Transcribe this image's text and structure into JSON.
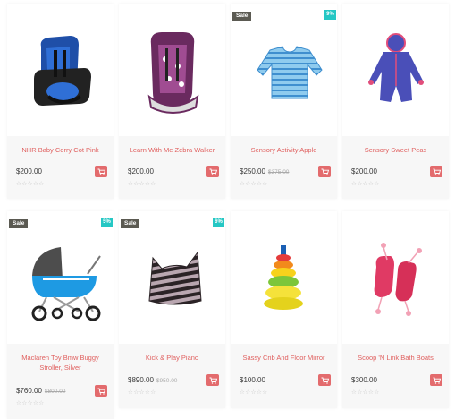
{
  "colors": {
    "title": "#e0605f",
    "cart_button": "#e36b6d",
    "sale_badge": "#5b5a52",
    "percent_badge": "#25c7c4",
    "info_bg": "#f7f7f7"
  },
  "products": [
    {
      "title": "NHR Baby Corry Cot Pink",
      "price": "$200.00",
      "old_price": "",
      "stars": "☆☆☆☆☆",
      "badge_sale": "",
      "badge_pct": "",
      "image": "car-seat-blue"
    },
    {
      "title": "Learn With Me Zebra Walker",
      "price": "$200.00",
      "old_price": "",
      "stars": "☆☆☆☆☆",
      "badge_sale": "",
      "badge_pct": "",
      "image": "car-seat-purple"
    },
    {
      "title": "Sensory Activity Apple",
      "price": "$250.00",
      "old_price": "$375.00",
      "stars": "☆☆☆☆☆",
      "badge_sale": "Sale",
      "badge_pct": "9%",
      "image": "striped-bodysuit"
    },
    {
      "title": "Sensory Sweet Peas",
      "price": "$200.00",
      "old_price": "",
      "stars": "☆☆☆☆☆",
      "badge_sale": "",
      "badge_pct": "",
      "image": "snowsuit"
    },
    {
      "title": "Maclaren Toy Bmw Buggy Stroller, Silver",
      "price": "$760.00",
      "old_price": "$800.00",
      "stars": "☆☆☆☆☆",
      "badge_sale": "Sale",
      "badge_pct": "5%",
      "image": "stroller"
    },
    {
      "title": "Kick & Play Piano",
      "price": "$890.00",
      "old_price": "$950.00",
      "stars": "☆☆☆☆☆",
      "badge_sale": "Sale",
      "badge_pct": "6%",
      "image": "knit-hat"
    },
    {
      "title": "Sassy Crib And Floor Mirror",
      "price": "$100.00",
      "old_price": "",
      "stars": "☆☆☆☆☆",
      "badge_sale": "",
      "badge_pct": "",
      "image": "ring-stacker"
    },
    {
      "title": "Scoop 'N Link Bath Boats",
      "price": "$300.00",
      "old_price": "",
      "stars": "☆☆☆☆☆",
      "badge_sale": "",
      "badge_pct": "",
      "image": "knit-booties"
    }
  ]
}
